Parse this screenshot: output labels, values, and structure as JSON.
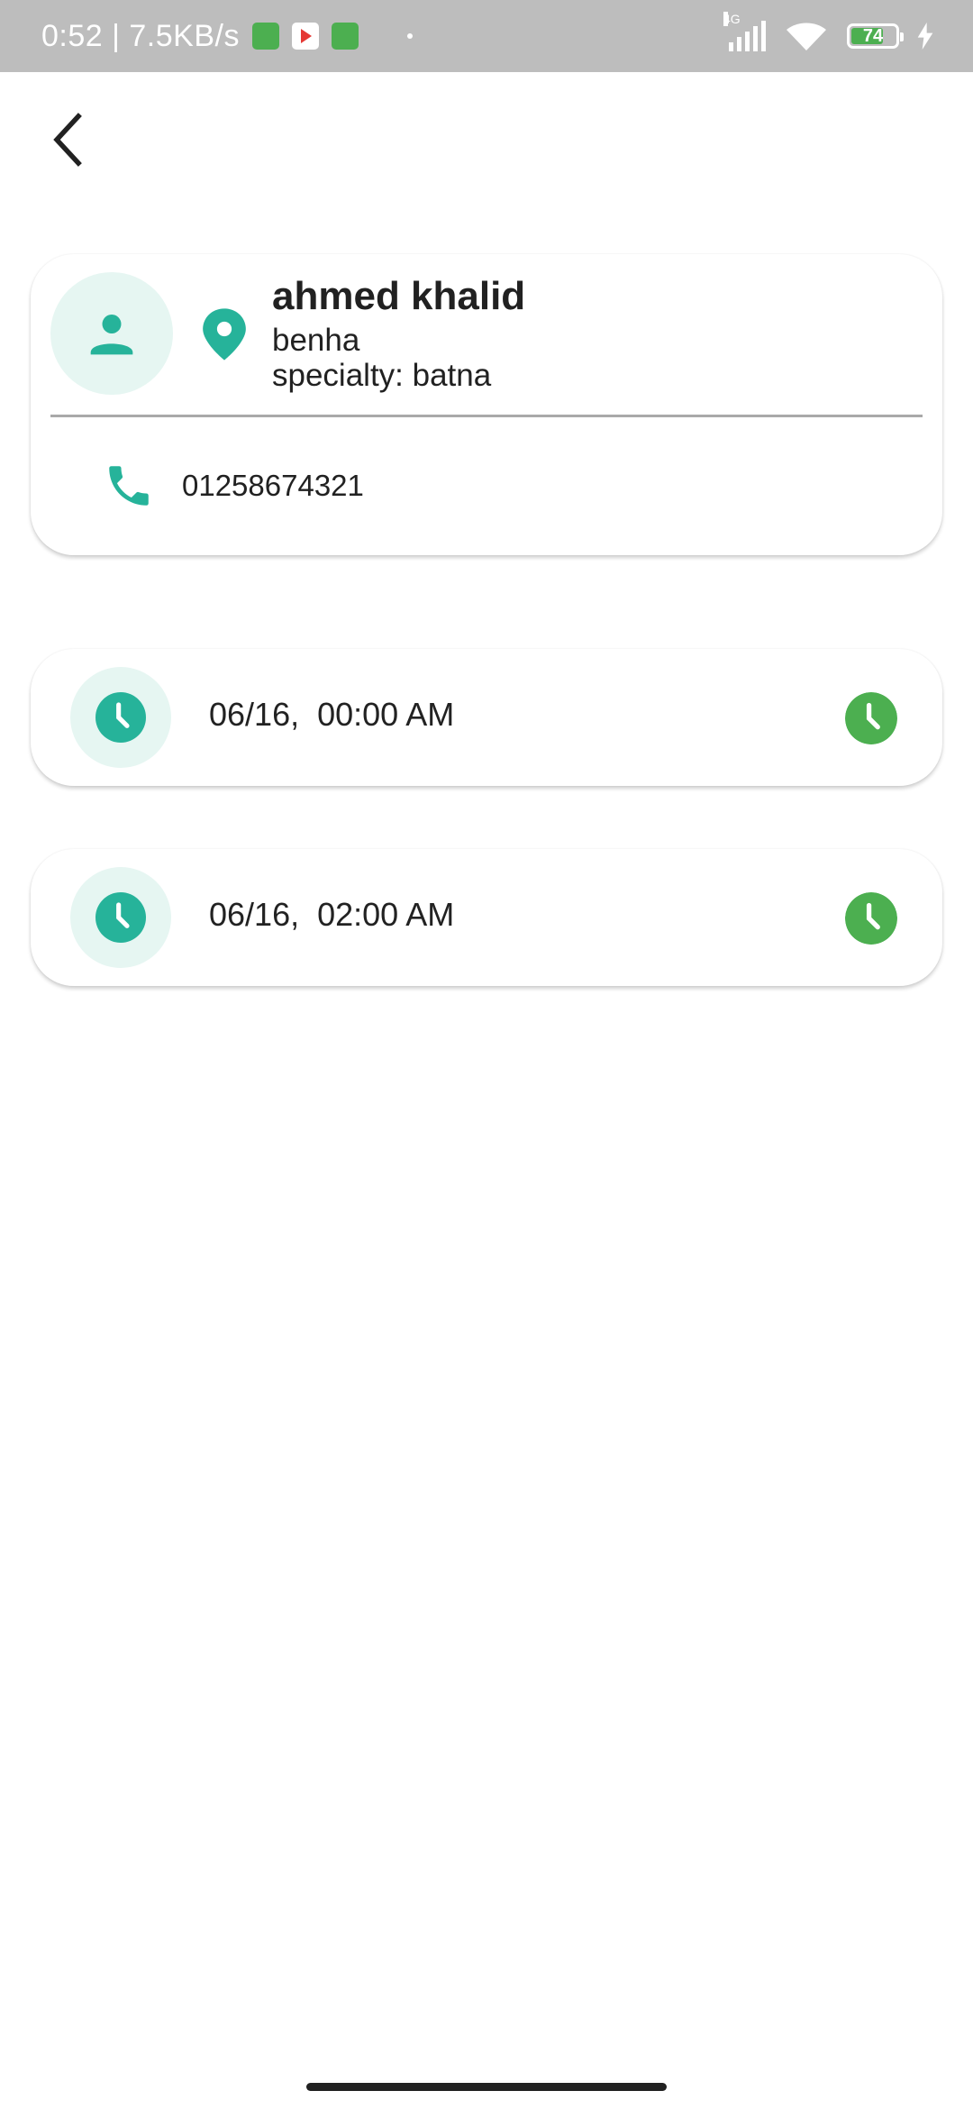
{
  "status_bar": {
    "time_and_speed": "0:52 | 7.5KB/s",
    "network": "4G",
    "battery": "74",
    "battery_level": 0.74
  },
  "profile": {
    "name": "ahmed khalid",
    "city": "benha",
    "specialty": "specialty: batna",
    "phone": "01258674321"
  },
  "slots": [
    {
      "time": "06/16,  00:00 AM"
    },
    {
      "time": "06/16,  02:00 AM"
    }
  ],
  "colors": {
    "accent": "#26b39a",
    "accent_light": "#e6f6f2",
    "action_green": "#4caf50",
    "status_bar_bg": "#bdbdbd"
  },
  "icons": {
    "back": "chevron-left-icon",
    "avatar": "person-icon",
    "location": "location-pin-icon",
    "phone": "phone-icon",
    "slot": "clock-icon",
    "slot_action": "clock-icon"
  }
}
